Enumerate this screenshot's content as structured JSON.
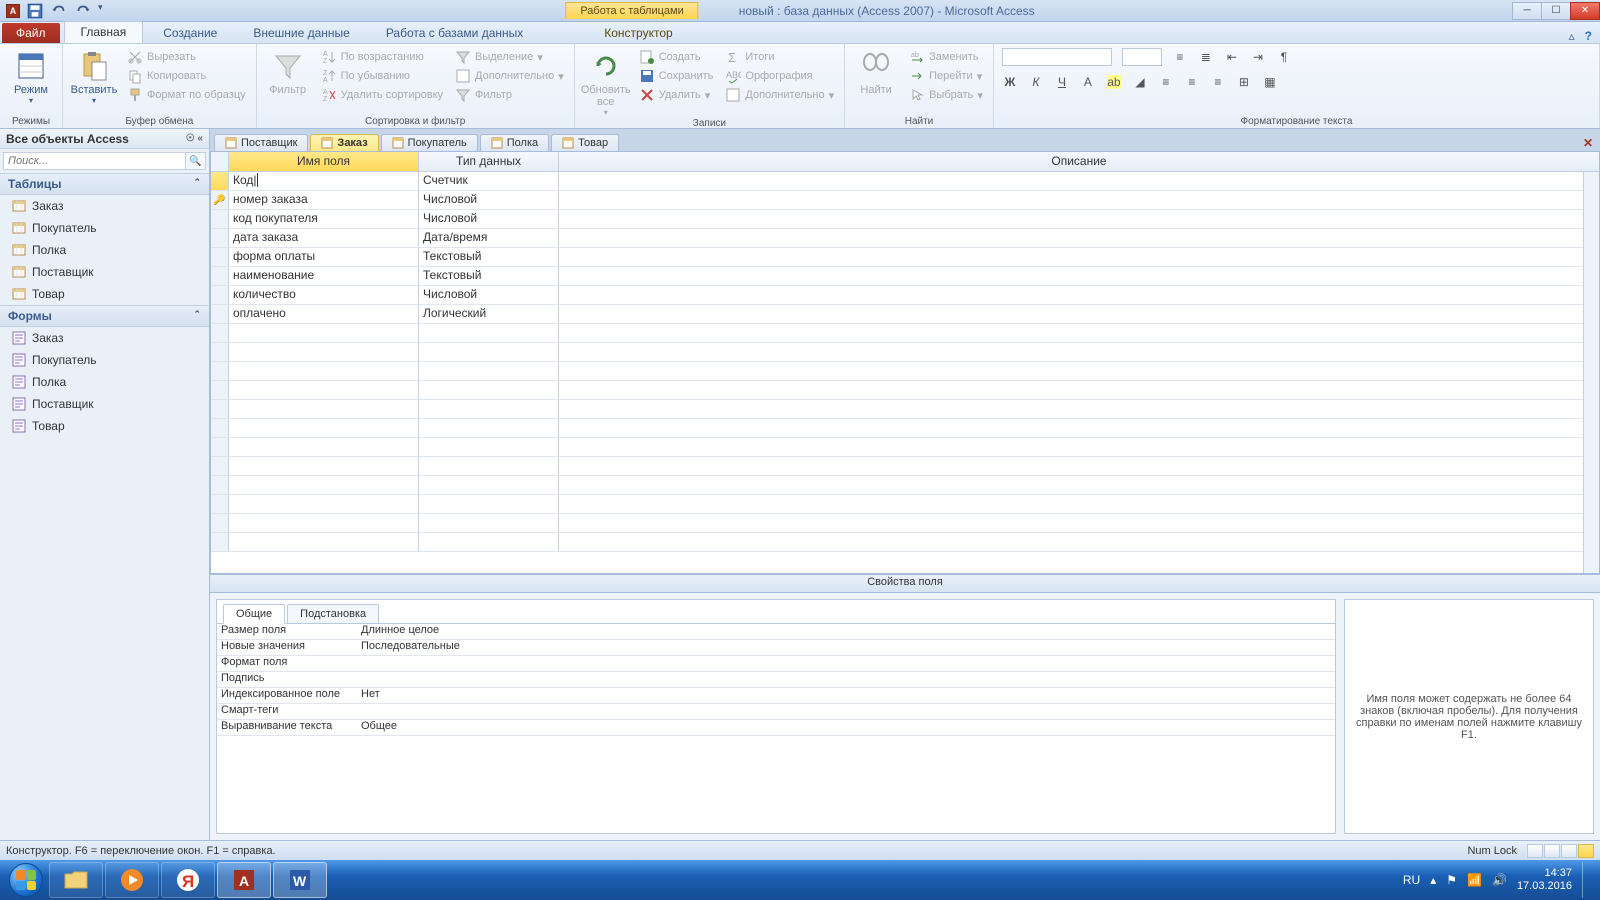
{
  "titlebar": {
    "contextual_label": "Работа с таблицами",
    "document_title": "новый : база данных (Access 2007) - Microsoft Access"
  },
  "ribbon": {
    "file_tab": "Файл",
    "tabs": [
      "Главная",
      "Создание",
      "Внешние данные",
      "Работа с базами данных",
      "Конструктор"
    ],
    "active_tab": "Главная",
    "groups": {
      "views": {
        "view_btn": "Режим",
        "label": "Режимы"
      },
      "clipboard": {
        "paste_btn": "Вставить",
        "cut": "Вырезать",
        "copy": "Копировать",
        "format_painter": "Формат по образцу",
        "label": "Буфер обмена"
      },
      "sort_filter": {
        "filter_btn": "Фильтр",
        "ascending": "По возрастанию",
        "descending": "По убыванию",
        "clear_sort": "Удалить сортировку",
        "selection": "Выделение",
        "advanced": "Дополнительно",
        "toggle_filter": "Фильтр",
        "label": "Сортировка и фильтр"
      },
      "records": {
        "refresh_btn": "Обновить все",
        "new_rec": "Создать",
        "save_rec": "Сохранить",
        "delete_rec": "Удалить",
        "totals": "Итоги",
        "spelling": "Орфография",
        "more": "Дополнительно",
        "label": "Записи"
      },
      "find": {
        "find_btn": "Найти",
        "replace": "Заменить",
        "goto": "Перейти",
        "select": "Выбрать",
        "label": "Найти"
      },
      "text_fmt": {
        "label": "Форматирование текста"
      }
    }
  },
  "navpane": {
    "title": "Все объекты Access",
    "search_placeholder": "Поиск...",
    "groups": [
      {
        "name": "Таблицы",
        "items": [
          "Заказ",
          "Покупатель",
          "Полка",
          "Поставщик",
          "Товар"
        ],
        "icon": "table"
      },
      {
        "name": "Формы",
        "items": [
          "Заказ",
          "Покупатель",
          "Полка",
          "Поставщик",
          "Товар"
        ],
        "icon": "form"
      }
    ]
  },
  "object_tabs": [
    "Поставщик",
    "Заказ",
    "Покупатель",
    "Полка",
    "Товар"
  ],
  "active_object_tab": "Заказ",
  "field_grid": {
    "headers": {
      "name": "Имя поля",
      "type": "Тип данных",
      "desc": "Описание"
    },
    "rows": [
      {
        "name": "Код",
        "type": "Счетчик",
        "selected": true,
        "key": false
      },
      {
        "name": "номер заказа",
        "type": "Числовой",
        "key": true
      },
      {
        "name": "код покупателя",
        "type": "Числовой"
      },
      {
        "name": "дата заказа",
        "type": "Дата/время"
      },
      {
        "name": "форма оплаты",
        "type": "Текстовый"
      },
      {
        "name": "наименование",
        "type": "Текстовый"
      },
      {
        "name": "количество",
        "type": "Числовой"
      },
      {
        "name": "оплачено",
        "type": "Логический"
      }
    ]
  },
  "properties": {
    "pane_title": "Свойства поля",
    "tabs": [
      "Общие",
      "Подстановка"
    ],
    "active_tab": "Общие",
    "rows": [
      {
        "label": "Размер поля",
        "value": "Длинное целое"
      },
      {
        "label": "Новые значения",
        "value": "Последовательные"
      },
      {
        "label": "Формат поля",
        "value": ""
      },
      {
        "label": "Подпись",
        "value": ""
      },
      {
        "label": "Индексированное поле",
        "value": "Нет"
      },
      {
        "label": "Смарт-теги",
        "value": ""
      },
      {
        "label": "Выравнивание текста",
        "value": "Общее"
      }
    ],
    "hint": "Имя поля может содержать не более 64 знаков (включая пробелы). Для получения справки по именам полей нажмите клавишу F1."
  },
  "statusbar": {
    "left": "Конструктор.  F6 = переключение окон.  F1 = справка.",
    "numlock": "Num Lock"
  },
  "taskbar": {
    "lang": "RU",
    "time": "14:37",
    "date": "17.03.2016"
  }
}
